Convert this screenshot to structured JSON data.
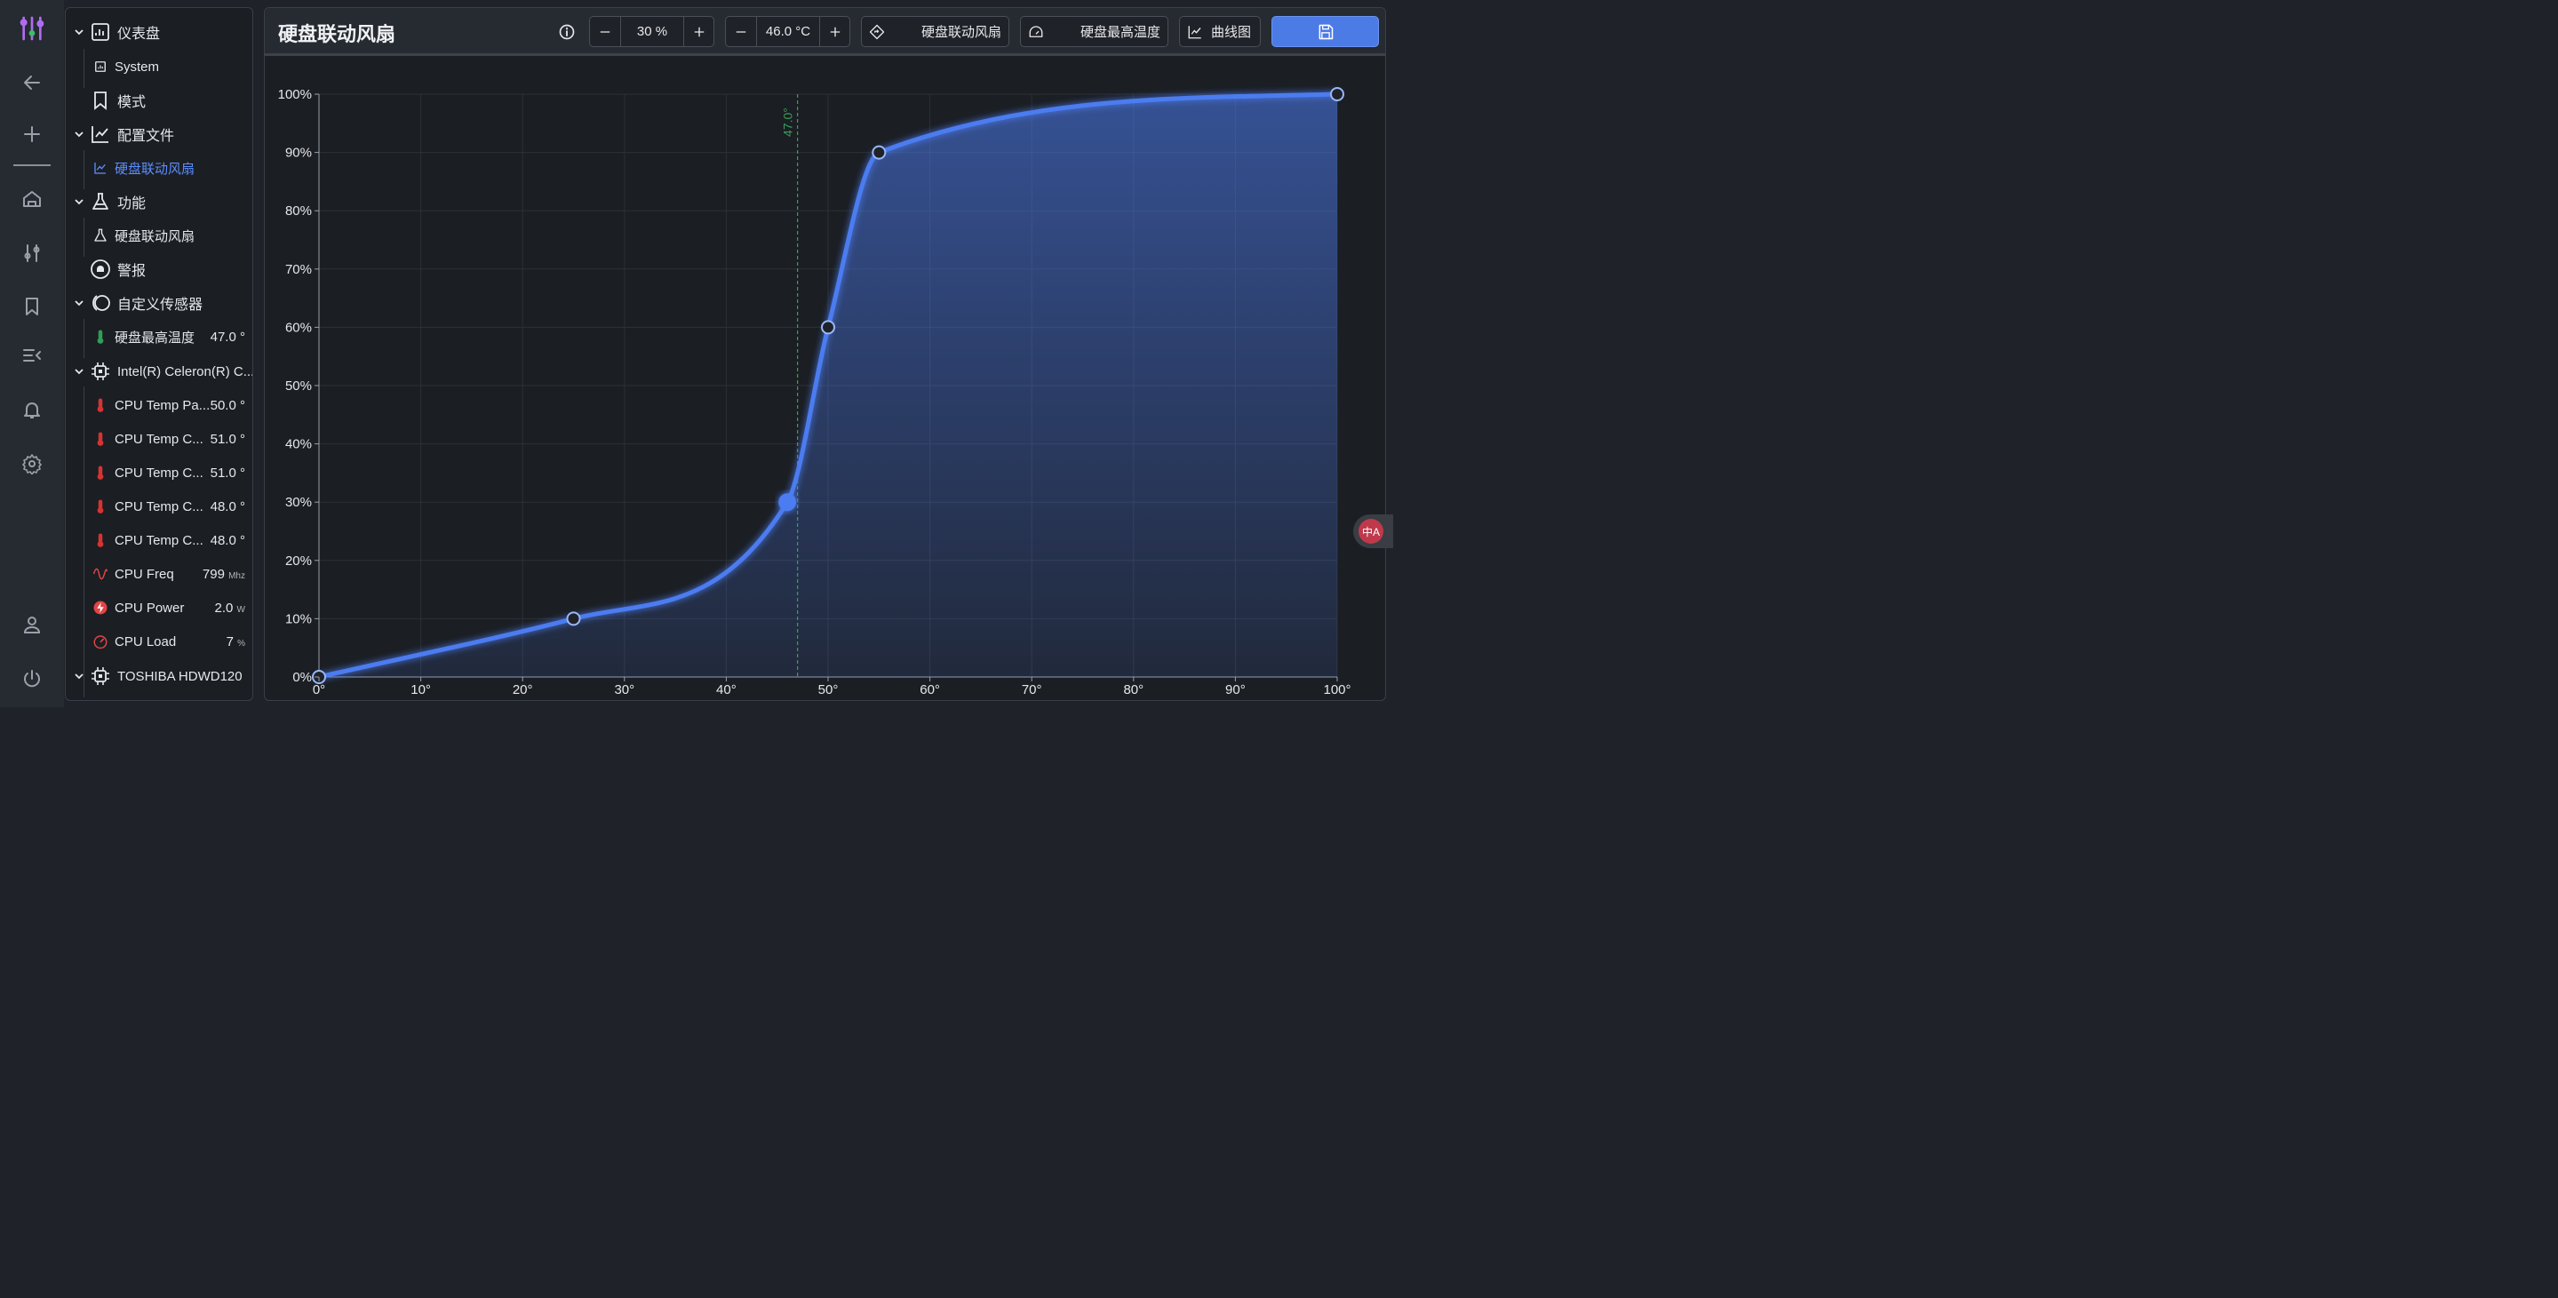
{
  "rail": {
    "icons": [
      "app-logo-icon",
      "back-arrow-icon",
      "plus-icon",
      "home-icon",
      "sliders-icon",
      "bookmark-icon",
      "list-collapse-icon",
      "bell-icon",
      "gear-icon",
      "user-icon",
      "power-icon"
    ]
  },
  "sidebar": {
    "dashboard": "仪表盘",
    "system": "System",
    "mode": "模式",
    "profiles": "配置文件",
    "profile_item": "硬盘联动风扇",
    "functions": "功能",
    "function_item": "硬盘联动风扇",
    "alerts": "警报",
    "custom_sensors": "自定义传感器",
    "custom_sensor_item": {
      "label": "硬盘最高温度",
      "value": "47.0 °"
    },
    "cpu_group": "Intel(R) Celeron(R) C...",
    "cpu_items": [
      {
        "label": "CPU Temp Pa...",
        "value": "50.0 °",
        "unit": ""
      },
      {
        "label": "CPU Temp C...",
        "value": "51.0 °",
        "unit": ""
      },
      {
        "label": "CPU Temp C...",
        "value": "51.0 °",
        "unit": ""
      },
      {
        "label": "CPU Temp C...",
        "value": "48.0 °",
        "unit": ""
      },
      {
        "label": "CPU Temp C...",
        "value": "48.0 °",
        "unit": ""
      },
      {
        "label": "CPU Freq",
        "value": "799",
        "unit": "Mhz"
      },
      {
        "label": "CPU Power",
        "value": "2.0",
        "unit": "W"
      },
      {
        "label": "CPU Load",
        "value": "7",
        "unit": "%"
      }
    ],
    "disk_group": "TOSHIBA HDWD120"
  },
  "header": {
    "title": "硬盘联动风扇",
    "speed_value": "30 %",
    "temp_value": "46.0 °C",
    "profile_select": "硬盘联动风扇",
    "sensor_select": "硬盘最高温度",
    "graph_button": "曲线图"
  },
  "chart_data": {
    "type": "line",
    "x": [
      0,
      25,
      46,
      50,
      55,
      100
    ],
    "y": [
      0,
      10,
      30,
      60,
      90,
      100
    ],
    "x_ticks": [
      "0°",
      "10°",
      "20°",
      "30°",
      "40°",
      "50°",
      "60°",
      "70°",
      "80°",
      "90°",
      "100°"
    ],
    "y_ticks": [
      "0%",
      "10%",
      "20%",
      "30%",
      "40%",
      "50%",
      "60%",
      "70%",
      "80%",
      "90%",
      "100%"
    ],
    "xlim": [
      0,
      100
    ],
    "ylim": [
      0,
      100
    ],
    "current_point": {
      "x": 46,
      "y": 30
    },
    "marker_line": {
      "x": 47,
      "label": "47.0°"
    },
    "grid": true,
    "line_color": "#4c7cf0",
    "marker_color": "#3aa05a"
  },
  "float_button": "中A"
}
